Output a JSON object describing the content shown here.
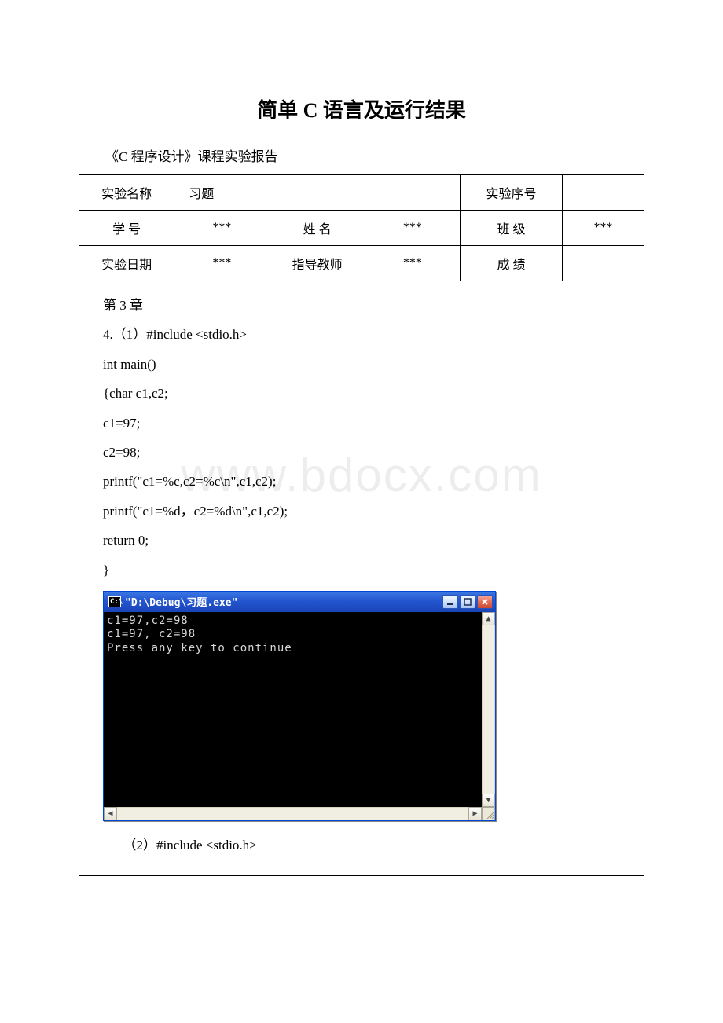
{
  "doc": {
    "title": "简单 C 语言及运行结果",
    "subtitle": "《C 程序设计》课程实验报告"
  },
  "meta": {
    "r1": {
      "c1": "实验名称",
      "c2": "习题",
      "c3": "实验序号",
      "c4": ""
    },
    "r2": {
      "c1": "学 号",
      "c2": "***",
      "c3": "姓 名",
      "c4": "***",
      "c5": "班 级",
      "c6": "***"
    },
    "r3": {
      "c1": "实验日期",
      "c2": "***",
      "c3": "指导教师",
      "c4": "***",
      "c5": "成 绩",
      "c6": ""
    }
  },
  "content": {
    "l1": "第 3 章",
    "l2": "4.（1）#include <stdio.h>",
    "l3": "int main()",
    "l4": "{char c1,c2;",
    "l5": " c1=97;",
    "l6": " c2=98;",
    "l7": " printf(\"c1=%c,c2=%c\\n\",c1,c2);",
    "l8": " printf(\"c1=%d，c2=%d\\n\",c1,c2);",
    "l9": " return 0;",
    "l10": "}",
    "l11": "（2）#include <stdio.h>"
  },
  "console": {
    "icon_text": "C:\\",
    "title": "\"D:\\Debug\\习题.exe\"",
    "out1": "c1=97,c2=98",
    "out2": "c1=97, c2=98",
    "out3": "Press any key to continue"
  },
  "watermark": "www.bdocx.com",
  "icons": {
    "minimize": "minimize-icon",
    "maximize": "maximize-icon",
    "close": "close-icon",
    "arrow_up": "▲",
    "arrow_down": "▼",
    "arrow_left": "◀",
    "arrow_right": "▶"
  }
}
